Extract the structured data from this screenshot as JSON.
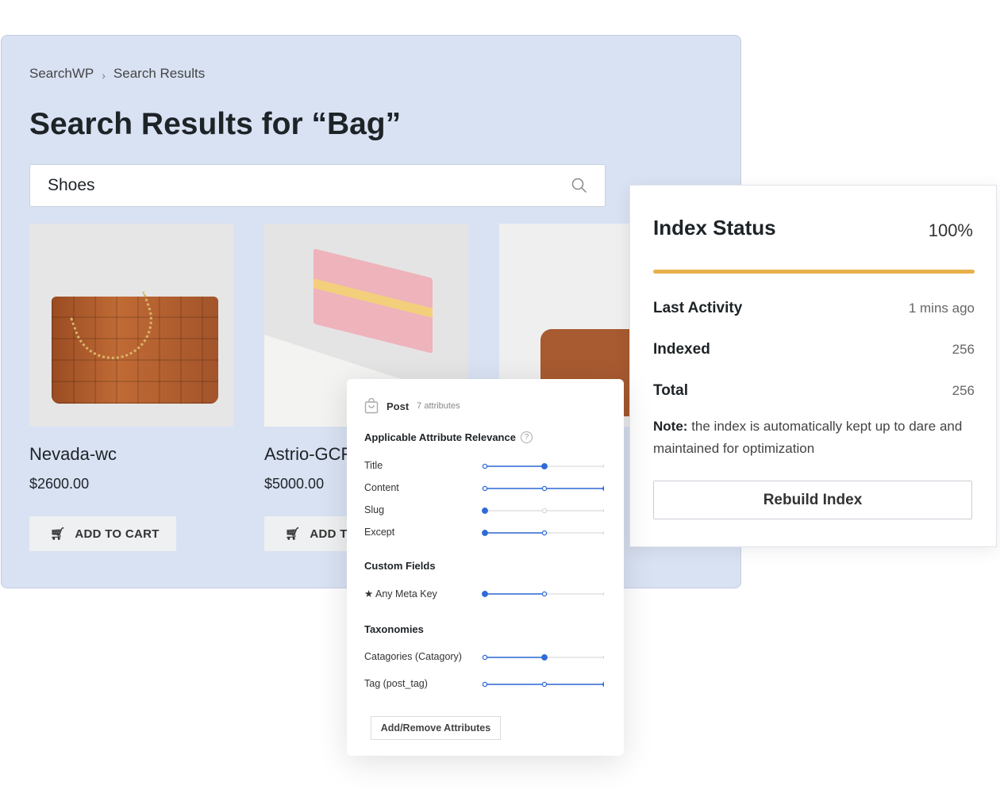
{
  "breadcrumb": {
    "root": "SearchWP",
    "current": "Search Results"
  },
  "page_title": "Search Results for “Bag”",
  "search": {
    "value": "Shoes"
  },
  "products": [
    {
      "name": "Nevada-wc",
      "price": "$2600.00",
      "cart_label": "ADD TO CART"
    },
    {
      "name": "Astrio-GCF",
      "price": "$5000.00",
      "cart_label": "ADD TO CART"
    },
    {}
  ],
  "index_status": {
    "title": "Index Status",
    "percent": "100%",
    "progress": 100,
    "accent": "#e8b04a",
    "last_activity_label": "Last Activity",
    "last_activity": "1 mins ago",
    "indexed_label": "Indexed",
    "indexed": "256",
    "total_label": "Total",
    "total": "256",
    "note_label": "Note:",
    "note": "the index is automatically kept up to dare and maintained for optimization",
    "rebuild_label": "Rebuild Index"
  },
  "attributes": {
    "post_label": "Post",
    "count": "7 attributes",
    "relevance_heading": "Applicable Attribute Relevance",
    "accent": "#2f6bd8",
    "rows": [
      {
        "label": "Title",
        "level": 1,
        "handle": 1
      },
      {
        "label": "Content",
        "level": 2,
        "handle": 2
      },
      {
        "label": "Slug",
        "level": 0,
        "handle": 0
      },
      {
        "label": "Except",
        "level": 1,
        "handle": 0
      }
    ],
    "custom_fields_heading": "Custom Fields",
    "custom_fields": [
      {
        "label": "★ Any Meta Key",
        "level": 1,
        "handle": 0
      }
    ],
    "taxonomies_heading": "Taxonomies",
    "taxonomies": [
      {
        "label": "Catagories (Catagory)",
        "level": 1,
        "handle": 1
      },
      {
        "label": "Tag (post_tag)",
        "level": 2,
        "handle": 2
      }
    ],
    "add_remove_label": "Add/Remove Attributes"
  }
}
